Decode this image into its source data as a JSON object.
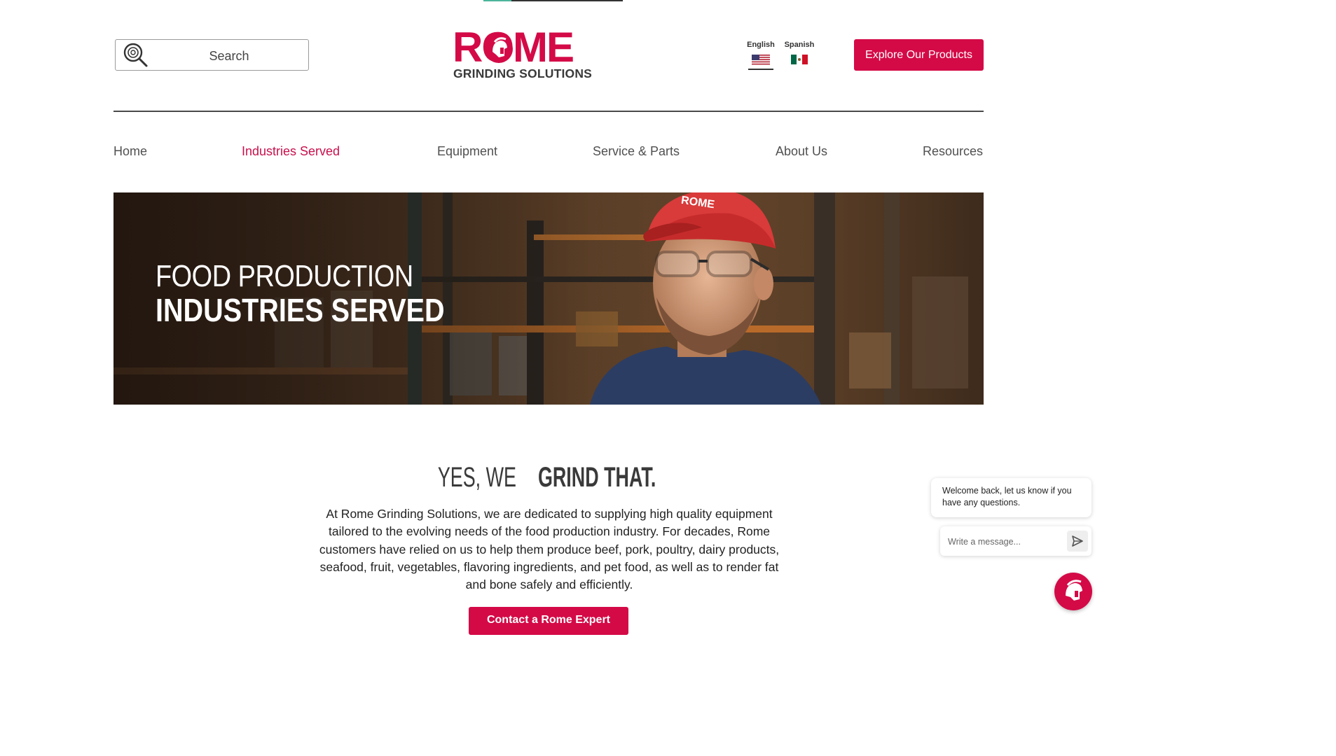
{
  "search": {
    "placeholder": "Search"
  },
  "logo": {
    "word": "ROME",
    "subtitle": "GRINDING SOLUTIONS"
  },
  "languages": [
    {
      "label": "English",
      "flag": "us-flag-icon",
      "selected": true
    },
    {
      "label": "Spanish",
      "flag": "mexico-flag-icon",
      "selected": false
    }
  ],
  "header": {
    "cta_label": "Explore Our Products"
  },
  "nav": {
    "items": [
      {
        "label": "Home",
        "active": false
      },
      {
        "label": "Industries Served",
        "active": true
      },
      {
        "label": "Equipment",
        "active": false
      },
      {
        "label": "Service & Parts",
        "active": false
      },
      {
        "label": "About Us",
        "active": false
      },
      {
        "label": "Resources",
        "active": false
      }
    ]
  },
  "hero": {
    "line1": "FOOD PRODUCTION",
    "line2": "INDUSTRIES SERVED",
    "cap_text": "ROME"
  },
  "section": {
    "heading_light": "YES, WE ",
    "heading_bold": "GRIND THAT.",
    "body": "At Rome Grinding Solutions, we are dedicated to supplying high quality equipment tailored to the evolving needs of the food production industry. For decades, Rome customers have relied on us to help them produce beef, pork, poultry, dairy products, seafood, fruit, vegetables, flavoring ingredients, and pet food, as well as to render fat and bone safely and efficiently.",
    "contact_label": "Contact a Rome Expert"
  },
  "chat": {
    "greeting": "Welcome back, let us know if you have any questions.",
    "placeholder": "Write a message..."
  },
  "colors": {
    "brand": "#d40a47",
    "nav_active": "#c8104c",
    "text": "#3a3a3a"
  }
}
